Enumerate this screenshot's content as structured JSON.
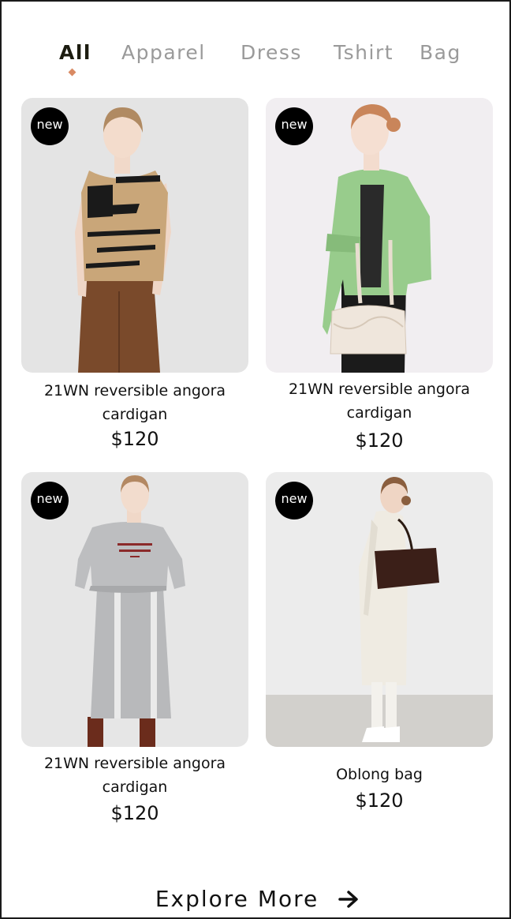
{
  "tabs": [
    {
      "label": "All"
    },
    {
      "label": "Apparel"
    },
    {
      "label": "Dress"
    },
    {
      "label": "Tshirt"
    },
    {
      "label": "Bag"
    }
  ],
  "accent_color": "#d98a63",
  "products": [
    {
      "badge": "new",
      "name": "21WN reversible angora cardigan",
      "price": "$120"
    },
    {
      "badge": "new",
      "name": "21WN reversible angora cardigan",
      "price": "$120"
    },
    {
      "badge": "new",
      "name": "21WN reversible angora cardigan",
      "price": "$120"
    },
    {
      "badge": "new",
      "name": "Oblong bag",
      "price": "$120"
    }
  ],
  "explore": {
    "label": "Explore More",
    "icon": "arrow-right-icon"
  }
}
